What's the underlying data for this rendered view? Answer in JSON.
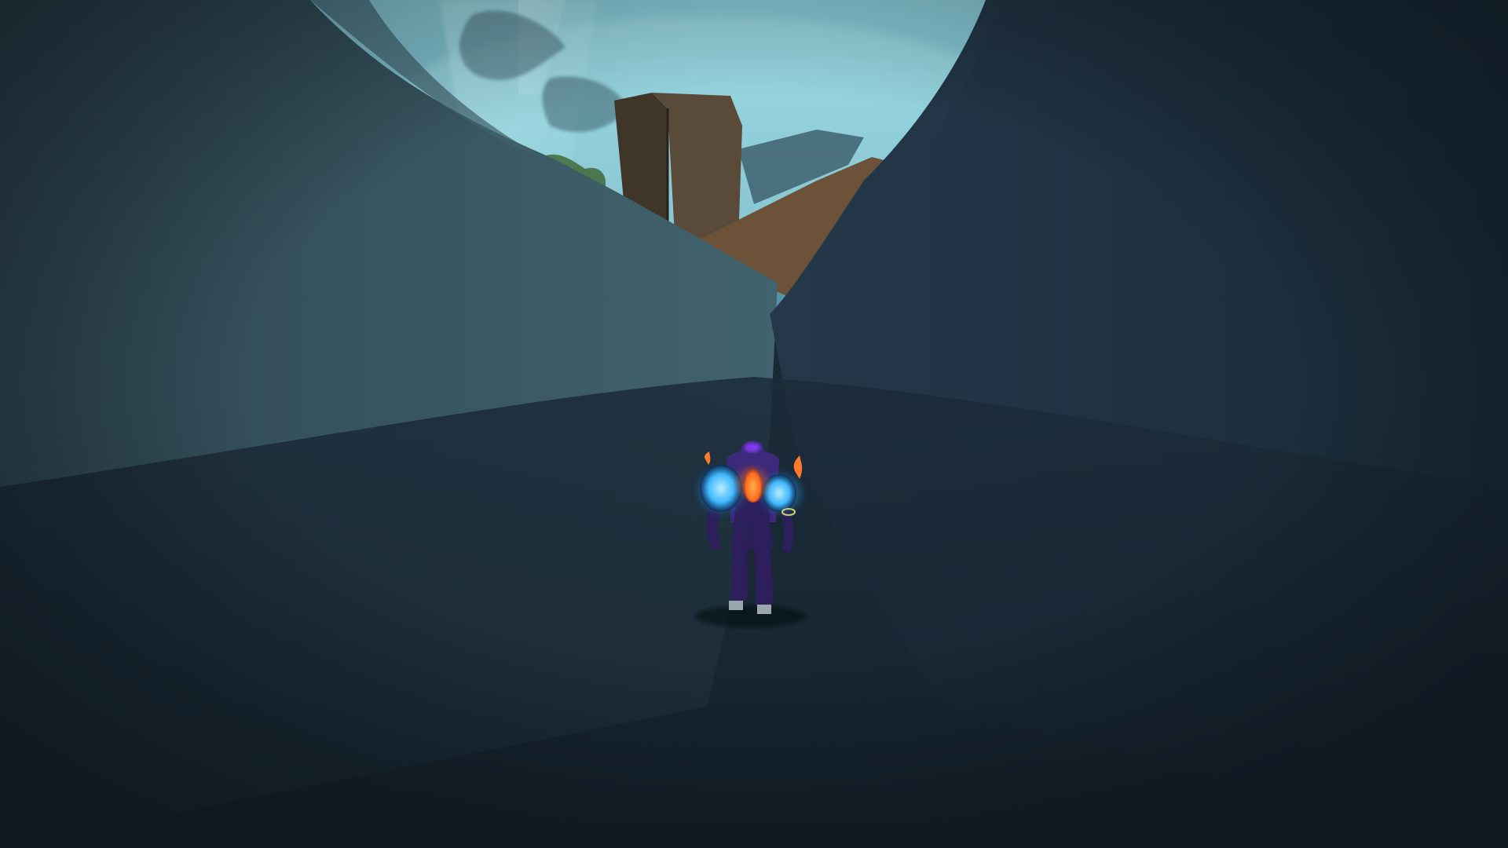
{
  "scene": {
    "description_hidden": "",
    "colors": {
      "sky_top": "#8fd3e0",
      "sky_bottom": "#4f8fa0",
      "sky_haze": "#a8e2ea",
      "light_shaft": "#c8f4f8",
      "rock_left": "#2e4652",
      "rock_left_lit": "#41636d",
      "rock_right": "#1a2c3a",
      "rock_right_edge": "#24384a",
      "canyon_floor": "#1b2b39",
      "canyon_floor_dark": "#15222d",
      "pillar_face": "#5a4a3a",
      "pillar_side": "#3f3528",
      "ledge": "#6b5238",
      "distant_rock": "#3a5a6a",
      "floating_island": "#456a78",
      "foliage": "#3f6a3a",
      "vignette": "#0c141b"
    },
    "character": {
      "armor_primary": "#2c1f5c",
      "armor_secondary": "#3d2a7a",
      "shoulder_glow": "#3fb8ff",
      "shoulder_core": "#b9ecff",
      "chest_fire": "#ff6a1a",
      "chest_fire_core": "#ffd36b",
      "helmet_glow": "#8a3cff",
      "back_fire": "#ff7a2a"
    }
  }
}
